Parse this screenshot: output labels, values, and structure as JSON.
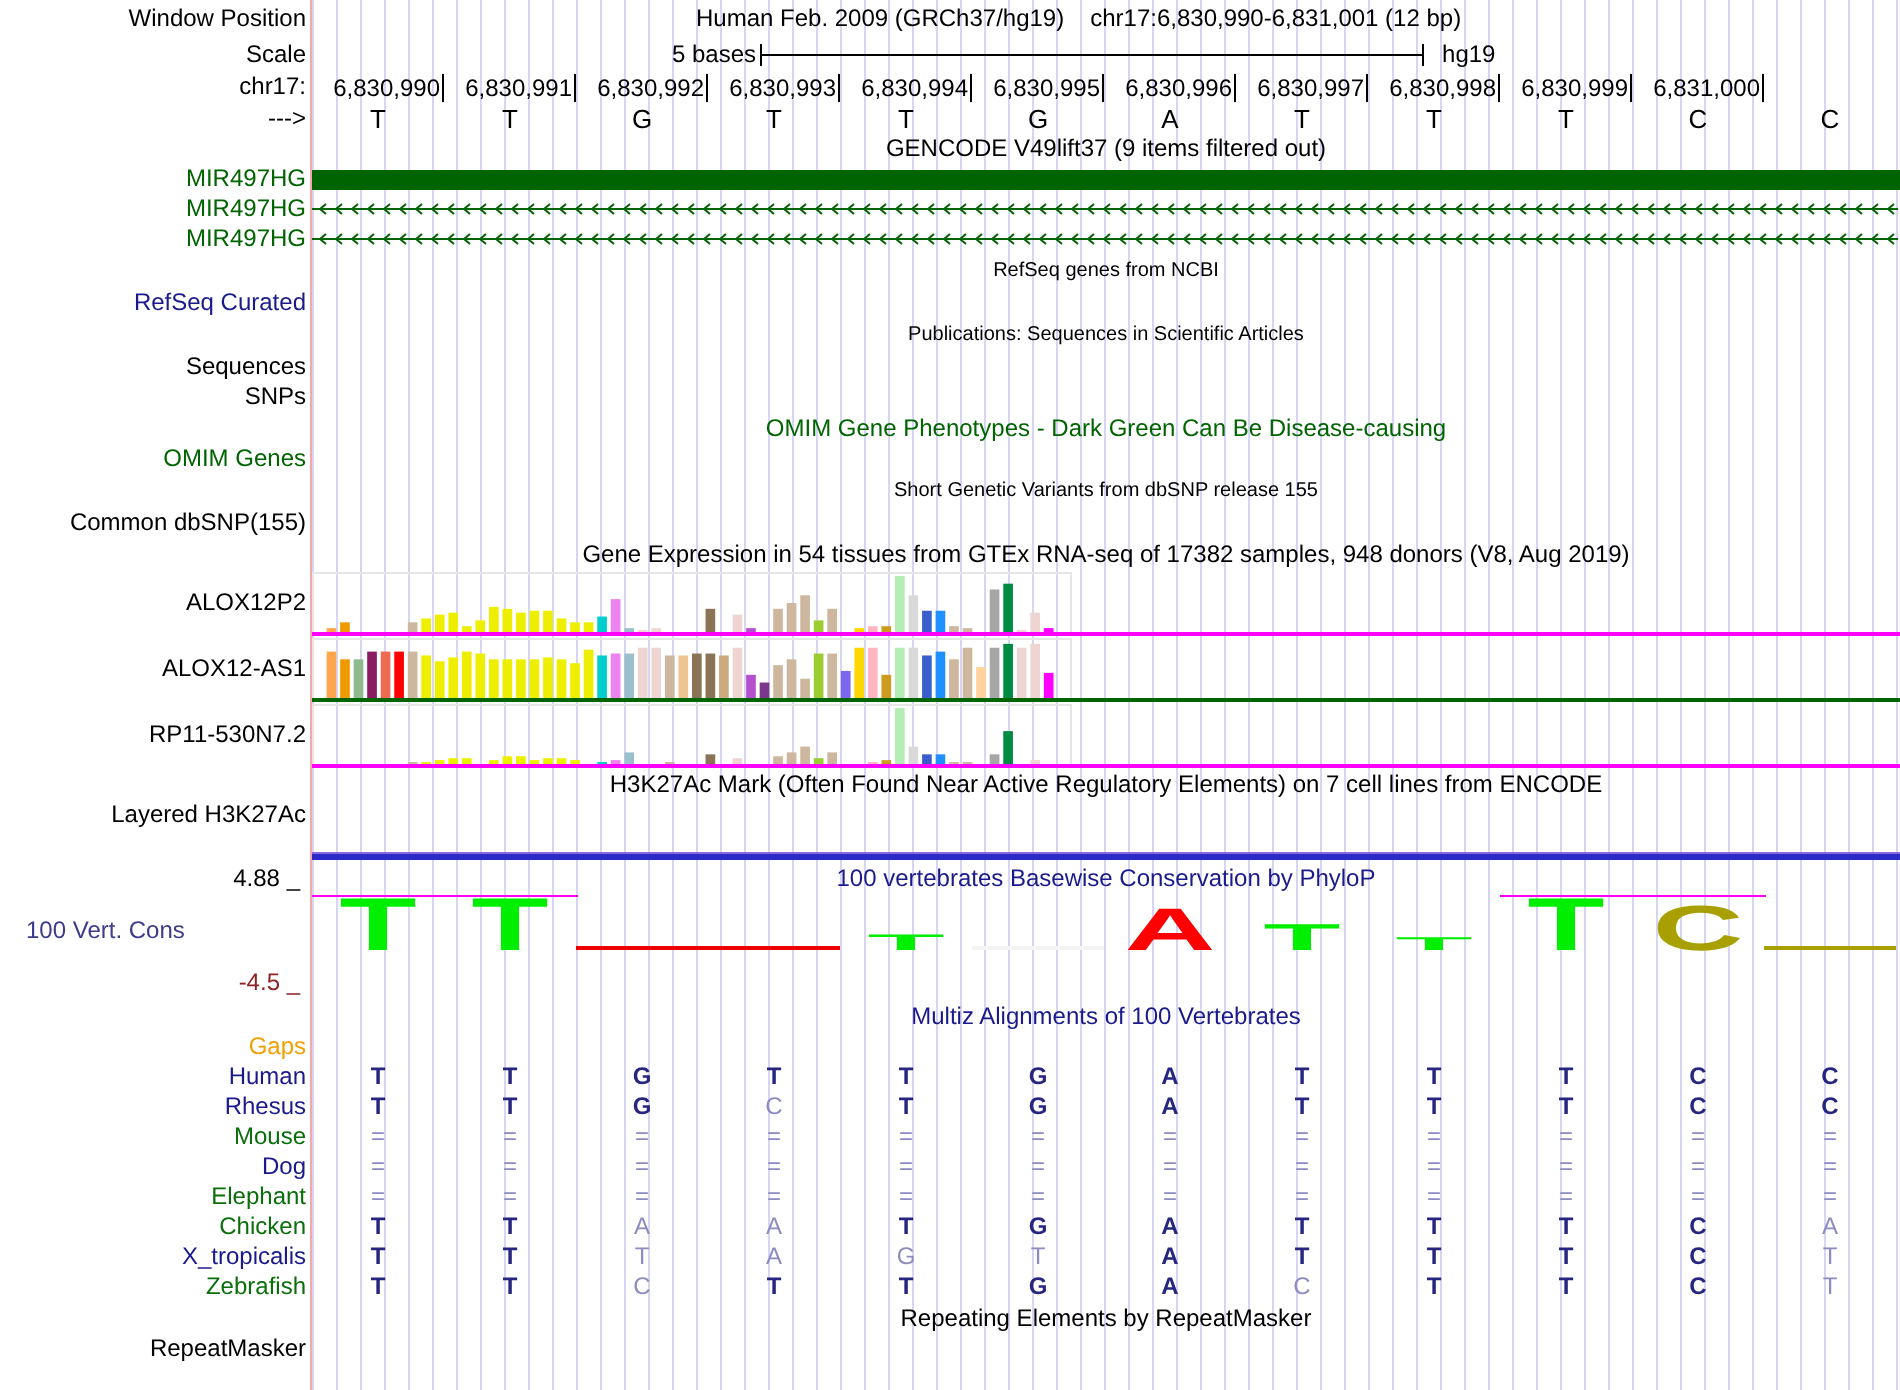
{
  "header": {
    "labels": [
      "Window Position",
      "Scale",
      "chr17:",
      "--->"
    ],
    "assembly": "Human Feb. 2009 (GRCh37/hg19)",
    "position": "chr17:6,830,990-6,831,001 (12 bp)",
    "scale_text": "5 bases",
    "scale_db": "hg19",
    "ruler": [
      "6,830,990",
      "6,830,991",
      "6,830,992",
      "6,830,993",
      "6,830,994",
      "6,830,995",
      "6,830,996",
      "6,830,997",
      "6,830,998",
      "6,830,999",
      "6,831,000"
    ],
    "bases": [
      "T",
      "T",
      "G",
      "T",
      "T",
      "G",
      "A",
      "T",
      "T",
      "T",
      "C",
      "C"
    ]
  },
  "tracks": [
    {
      "kind": "genes",
      "title": "GENCODE V49lift37 (9 items filtered out)",
      "rows": [
        {
          "label": "MIR497HG",
          "color": "#006400",
          "kind": "block"
        },
        {
          "label": "MIR497HG",
          "color": "#006400",
          "kind": "arrows"
        },
        {
          "label": "MIR497HG",
          "color": "#006400",
          "kind": "arrows"
        }
      ]
    },
    {
      "kind": "empty",
      "title": "RefSeq genes from NCBI",
      "small": true,
      "labels": [
        {
          "text": "RefSeq Curated",
          "color": "#1a1a8c"
        }
      ]
    },
    {
      "kind": "empty",
      "title": "Publications: Sequences in Scientific Articles",
      "small": true,
      "labels": [
        {
          "text": "Sequences",
          "color": "#000000"
        },
        {
          "text": "SNPs",
          "color": "#000000"
        }
      ]
    },
    {
      "kind": "empty",
      "title": "OMIM Gene Phenotypes - Dark Green Can Be Disease-causing",
      "color": "#006400",
      "labels": [
        {
          "text": "OMIM Genes",
          "color": "#006400"
        }
      ]
    },
    {
      "kind": "empty",
      "title": "Short Genetic Variants from dbSNP release 155",
      "small": true,
      "labels": [
        {
          "text": "Common dbSNP(155)",
          "color": "#000000"
        }
      ]
    },
    {
      "kind": "expression",
      "title": "Gene Expression in 54 tissues from GTEx RNA-seq of 17382 samples, 948 donors (V8, Aug 2019)",
      "rows": [
        {
          "label": "ALOX12P2",
          "color": "#ff00ff"
        },
        {
          "label": "ALOX12-AS1",
          "color": "#006400"
        },
        {
          "label": "RP11-530N7.2",
          "color": "#ff00ff"
        }
      ]
    },
    {
      "kind": "layered",
      "title": "H3K27Ac Mark (Often Found Near Active Regulatory Elements) on 7 cell lines from ENCODE",
      "labels": [
        {
          "text": "Layered H3K27Ac",
          "color": "#000000"
        }
      ]
    },
    {
      "kind": "conservation",
      "title": "100 vertebrates Basewise Conservation by PhyloP",
      "color": "#1a1a8c",
      "labels": [
        {
          "text": "100 Vert. Cons",
          "color": "#3c3c8c"
        }
      ],
      "max": "4.88 _",
      "min": "-4.5 _",
      "logo": [
        {
          "kind": "letter",
          "base": "T",
          "color": "#00ee00"
        },
        {
          "kind": "letter",
          "base": "T",
          "color": "#00ee00"
        },
        {
          "kind": "flat",
          "color": "#ee0000"
        },
        {
          "kind": "flat",
          "color": "#ee0000"
        },
        {
          "kind": "letter",
          "base": "T",
          "color": "#00ee00"
        },
        {
          "kind": "flat",
          "color": "#f4f4f4"
        },
        {
          "kind": "letter",
          "base": "A",
          "color": "#ff0000"
        },
        {
          "kind": "letter",
          "base": "T",
          "color": "#00ee00"
        },
        {
          "kind": "letter",
          "base": "T",
          "color": "#00ee00"
        },
        {
          "kind": "letter",
          "base": "T",
          "color": "#00ee00"
        },
        {
          "kind": "letter",
          "base": "C",
          "color": "#a8a000"
        },
        {
          "kind": "flat",
          "color": "#a8a000"
        }
      ]
    },
    {
      "kind": "multiz",
      "title": "Multiz Alignments of 100 Vertebrates",
      "color": "#1a1a8c",
      "gaps": {
        "text": "Gaps",
        "color": "#f0a000"
      },
      "species": [
        {
          "name": "Human",
          "color": "#1a1a8c",
          "bases": [
            {
              "base": "T",
              "dimmed": false
            },
            {
              "base": "T",
              "dimmed": false
            },
            {
              "base": "G",
              "dimmed": false
            },
            {
              "base": "T",
              "dimmed": false
            },
            {
              "base": "T",
              "dimmed": false
            },
            {
              "base": "G",
              "dimmed": false
            },
            {
              "base": "A",
              "dimmed": false
            },
            {
              "base": "T",
              "dimmed": false
            },
            {
              "base": "T",
              "dimmed": false
            },
            {
              "base": "T",
              "dimmed": false
            },
            {
              "base": "C",
              "dimmed": false
            },
            {
              "base": "C",
              "dimmed": false
            }
          ]
        },
        {
          "name": "Rhesus",
          "color": "#1a1a8c",
          "bases": [
            {
              "base": "T",
              "dimmed": false
            },
            {
              "base": "T",
              "dimmed": false
            },
            {
              "base": "G",
              "dimmed": false
            },
            {
              "base": "C",
              "dimmed": true
            },
            {
              "base": "T",
              "dimmed": false
            },
            {
              "base": "G",
              "dimmed": false
            },
            {
              "base": "A",
              "dimmed": false
            },
            {
              "base": "T",
              "dimmed": false
            },
            {
              "base": "T",
              "dimmed": false
            },
            {
              "base": "T",
              "dimmed": false
            },
            {
              "base": "C",
              "dimmed": false
            },
            {
              "base": "C",
              "dimmed": false
            }
          ]
        },
        {
          "name": "Mouse",
          "color": "#0a6e0a",
          "bases": [
            {
              "base": "=",
              "dimmed": true
            },
            {
              "base": "=",
              "dimmed": true
            },
            {
              "base": "=",
              "dimmed": true
            },
            {
              "base": "=",
              "dimmed": true
            },
            {
              "base": "=",
              "dimmed": true
            },
            {
              "base": "=",
              "dimmed": true
            },
            {
              "base": "=",
              "dimmed": true
            },
            {
              "base": "=",
              "dimmed": true
            },
            {
              "base": "=",
              "dimmed": true
            },
            {
              "base": "=",
              "dimmed": true
            },
            {
              "base": "=",
              "dimmed": true
            },
            {
              "base": "=",
              "dimmed": true
            }
          ]
        },
        {
          "name": "Dog",
          "color": "#1a1a8c",
          "bases": [
            {
              "base": "=",
              "dimmed": true
            },
            {
              "base": "=",
              "dimmed": true
            },
            {
              "base": "=",
              "dimmed": true
            },
            {
              "base": "=",
              "dimmed": true
            },
            {
              "base": "=",
              "dimmed": true
            },
            {
              "base": "=",
              "dimmed": true
            },
            {
              "base": "=",
              "dimmed": true
            },
            {
              "base": "=",
              "dimmed": true
            },
            {
              "base": "=",
              "dimmed": true
            },
            {
              "base": "=",
              "dimmed": true
            },
            {
              "base": "=",
              "dimmed": true
            },
            {
              "base": "=",
              "dimmed": true
            }
          ]
        },
        {
          "name": "Elephant",
          "color": "#0a6e0a",
          "bases": [
            {
              "base": "=",
              "dimmed": true
            },
            {
              "base": "=",
              "dimmed": true
            },
            {
              "base": "=",
              "dimmed": true
            },
            {
              "base": "=",
              "dimmed": true
            },
            {
              "base": "=",
              "dimmed": true
            },
            {
              "base": "=",
              "dimmed": true
            },
            {
              "base": "=",
              "dimmed": true
            },
            {
              "base": "=",
              "dimmed": true
            },
            {
              "base": "=",
              "dimmed": true
            },
            {
              "base": "=",
              "dimmed": true
            },
            {
              "base": "=",
              "dimmed": true
            },
            {
              "base": "=",
              "dimmed": true
            }
          ]
        },
        {
          "name": "Chicken",
          "color": "#0a6e0a",
          "bases": [
            {
              "base": "T",
              "dimmed": false
            },
            {
              "base": "T",
              "dimmed": false
            },
            {
              "base": "A",
              "dimmed": true
            },
            {
              "base": "A",
              "dimmed": true
            },
            {
              "base": "T",
              "dimmed": false
            },
            {
              "base": "G",
              "dimmed": false
            },
            {
              "base": "A",
              "dimmed": false
            },
            {
              "base": "T",
              "dimmed": false
            },
            {
              "base": "T",
              "dimmed": false
            },
            {
              "base": "T",
              "dimmed": false
            },
            {
              "base": "C",
              "dimmed": false
            },
            {
              "base": "A",
              "dimmed": true
            }
          ]
        },
        {
          "name": "X_tropicalis",
          "color": "#1a1a8c",
          "bases": [
            {
              "base": "T",
              "dimmed": false
            },
            {
              "base": "T",
              "dimmed": false
            },
            {
              "base": "T",
              "dimmed": true
            },
            {
              "base": "A",
              "dimmed": true
            },
            {
              "base": "G",
              "dimmed": true
            },
            {
              "base": "T",
              "dimmed": true
            },
            {
              "base": "A",
              "dimmed": false
            },
            {
              "base": "T",
              "dimmed": false
            },
            {
              "base": "T",
              "dimmed": false
            },
            {
              "base": "T",
              "dimmed": false
            },
            {
              "base": "C",
              "dimmed": false
            },
            {
              "base": "T",
              "dimmed": true
            }
          ]
        },
        {
          "name": "Zebrafish",
          "color": "#0a6e0a",
          "bases": [
            {
              "base": "T",
              "dimmed": false
            },
            {
              "base": "T",
              "dimmed": false
            },
            {
              "base": "C",
              "dimmed": true
            },
            {
              "base": "T",
              "dimmed": false
            },
            {
              "base": "T",
              "dimmed": false
            },
            {
              "base": "G",
              "dimmed": false
            },
            {
              "base": "A",
              "dimmed": false
            },
            {
              "base": "C",
              "dimmed": true
            },
            {
              "base": "T",
              "dimmed": false
            },
            {
              "base": "T",
              "dimmed": false
            },
            {
              "base": "C",
              "dimmed": false
            },
            {
              "base": "T",
              "dimmed": true
            }
          ]
        }
      ]
    },
    {
      "kind": "empty",
      "title": "Repeating Elements by RepeatMasker",
      "labels": [
        {
          "text": "RepeatMasker",
          "color": "#000000"
        }
      ]
    }
  ]
}
